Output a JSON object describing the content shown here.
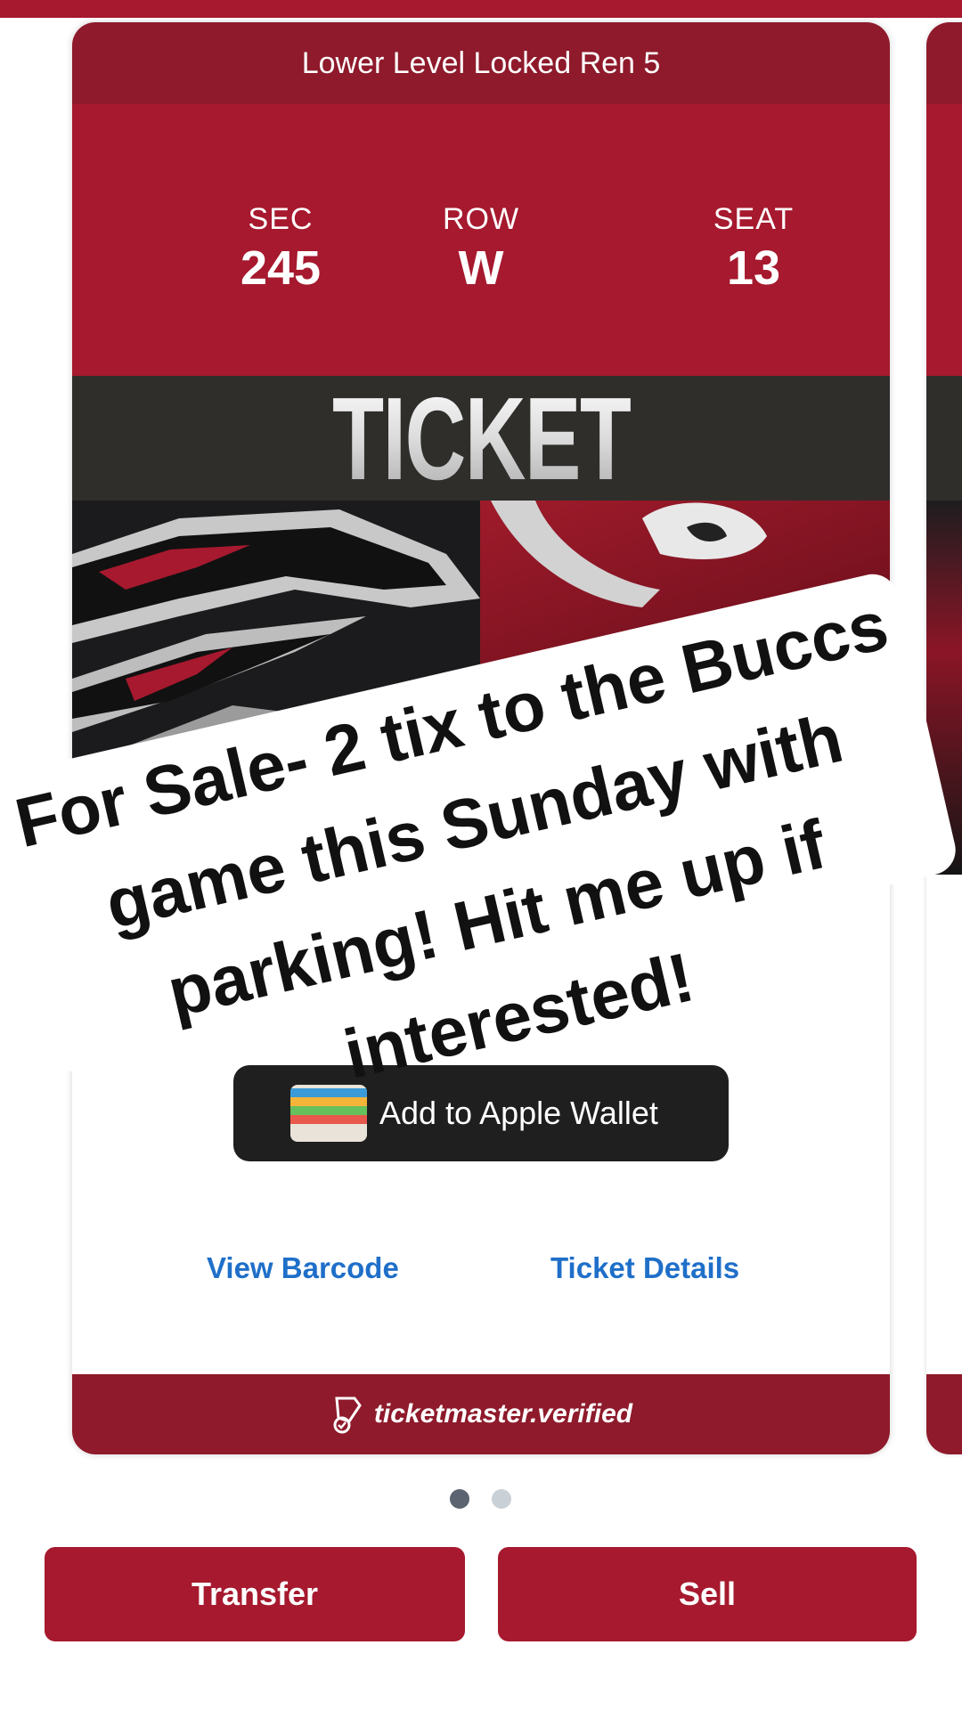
{
  "ticket": {
    "section_title": "Lower Level Locked Ren 5",
    "sec_label": "SEC",
    "sec_value": "245",
    "row_label": "ROW",
    "row_value": "W",
    "seat_label": "SEAT",
    "seat_value": "13",
    "banner_text": "TICKET",
    "wallet_label": "Add to Apple Wallet",
    "view_barcode": "View Barcode",
    "ticket_details": "Ticket Details",
    "footer_brand": "ticketmaster.verified"
  },
  "pager": {
    "total": 2,
    "active": 1
  },
  "actions": {
    "transfer_label": "Transfer",
    "sell_label": "Sell"
  },
  "overlay": {
    "text": "For Sale- 2 tix to the Buccs game this Sunday with parking! Hit me up if interested!"
  },
  "colors": {
    "brand_red": "#a6192e",
    "header_red": "#8e1a2b",
    "link_blue": "#1f6fc9",
    "wallet_black": "#1f1f1f"
  },
  "icons": [
    "apple-wallet-icon",
    "ticketmaster-verified-icon"
  ]
}
